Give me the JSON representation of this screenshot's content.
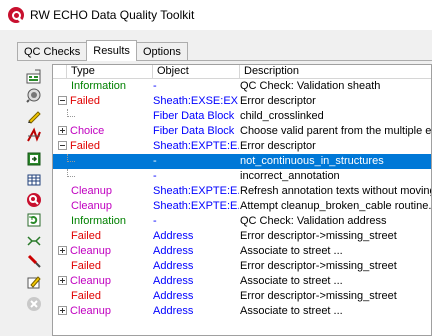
{
  "window": {
    "title": "RW ECHO Data Quality Toolkit"
  },
  "tabs": [
    {
      "label": "QC Checks",
      "active": false
    },
    {
      "label": "Results",
      "active": true
    },
    {
      "label": "Options",
      "active": false
    }
  ],
  "toolbar": {
    "buttons": [
      "run-check-icon",
      "inspect-icon",
      "pencil-icon",
      "path-icon",
      "export-icon",
      "grid-icon",
      "brand-icon",
      "refresh-icon",
      "link-icon",
      "wrench-icon",
      "edit-icon",
      "cancel-icon"
    ]
  },
  "grid": {
    "columns": [
      "Type",
      "Object",
      "Description"
    ],
    "rows": [
      {
        "type": "Information",
        "type_color": "info",
        "expander": "",
        "object": "-",
        "object_color": "link",
        "description": "QC Check: Validation sheath",
        "selected": false,
        "indent": 0
      },
      {
        "type": "Failed",
        "type_color": "failed",
        "expander": "minus",
        "object": "Sheath:EXSE:EX...",
        "object_color": "link",
        "description": "Error descriptor",
        "selected": false,
        "indent": 0
      },
      {
        "type": "",
        "type_color": "",
        "expander": "",
        "object": "Fiber Data Block",
        "object_color": "link",
        "description": "child_crosslinked",
        "selected": false,
        "indent": 1
      },
      {
        "type": "Choice",
        "type_color": "choice",
        "expander": "plus",
        "object": "Fiber Data Block",
        "object_color": "link",
        "description": "Choose valid parent from the multiple existing",
        "selected": false,
        "indent": 0
      },
      {
        "type": "Failed",
        "type_color": "failed",
        "expander": "minus",
        "object": "Sheath:EXPTE:E...",
        "object_color": "link",
        "description": "Error descriptor",
        "selected": false,
        "indent": 0
      },
      {
        "type": "",
        "type_color": "",
        "expander": "",
        "object": "-",
        "object_color": "link",
        "description": "not_continuous_in_structures",
        "selected": true,
        "indent": 1
      },
      {
        "type": "",
        "type_color": "",
        "expander": "",
        "object": "-",
        "object_color": "link",
        "description": "incorrect_annotation",
        "selected": false,
        "indent": 1
      },
      {
        "type": "Cleanup",
        "type_color": "cleanup",
        "expander": "",
        "object": "Sheath:EXPTE:E...",
        "object_color": "link",
        "description": "Refresh annotation texts without moving",
        "selected": false,
        "indent": 0
      },
      {
        "type": "Cleanup",
        "type_color": "cleanup",
        "expander": "",
        "object": "Sheath:EXPTE:E...",
        "object_color": "link",
        "description": "Attempt cleanup_broken_cable routine.",
        "selected": false,
        "indent": 0
      },
      {
        "type": "Information",
        "type_color": "info",
        "expander": "",
        "object": "-",
        "object_color": "link",
        "description": "QC Check: Validation address",
        "selected": false,
        "indent": 0
      },
      {
        "type": "Failed",
        "type_color": "failed",
        "expander": "",
        "object": "Address",
        "object_color": "link",
        "description": "Error descriptor->missing_street",
        "selected": false,
        "indent": 0
      },
      {
        "type": "Cleanup",
        "type_color": "cleanup",
        "expander": "plus",
        "object": "Address",
        "object_color": "link",
        "description": "Associate to street ...",
        "selected": false,
        "indent": 0
      },
      {
        "type": "Failed",
        "type_color": "failed",
        "expander": "",
        "object": "Address",
        "object_color": "link",
        "description": "Error descriptor->missing_street",
        "selected": false,
        "indent": 0
      },
      {
        "type": "Cleanup",
        "type_color": "cleanup",
        "expander": "plus",
        "object": "Address",
        "object_color": "link",
        "description": "Associate to street ...",
        "selected": false,
        "indent": 0
      },
      {
        "type": "Failed",
        "type_color": "failed",
        "expander": "",
        "object": "Address",
        "object_color": "link",
        "description": "Error descriptor->missing_street",
        "selected": false,
        "indent": 0
      },
      {
        "type": "Cleanup",
        "type_color": "cleanup",
        "expander": "plus",
        "object": "Address",
        "object_color": "link",
        "description": "Associate to street ...",
        "selected": false,
        "indent": 0
      }
    ]
  }
}
